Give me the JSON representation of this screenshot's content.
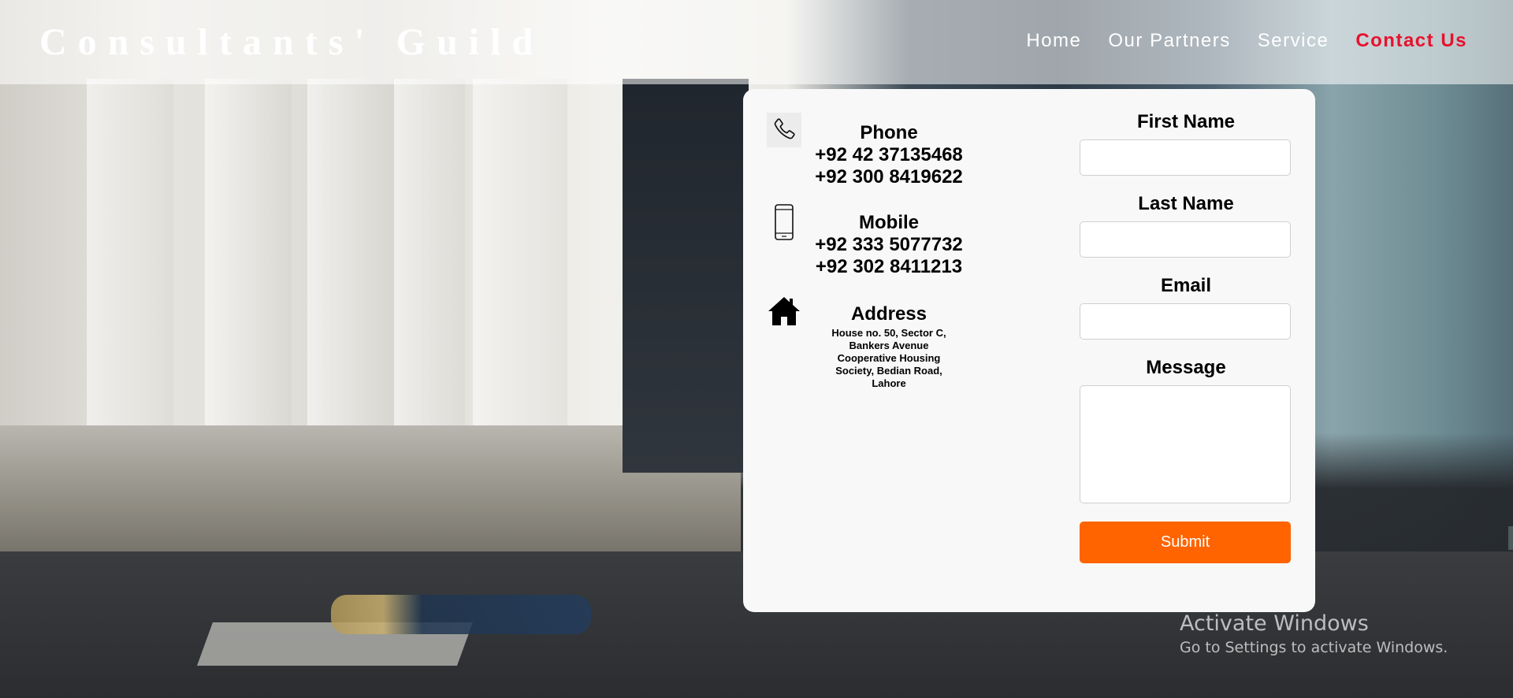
{
  "brand": {
    "name": "Consultants' Guild"
  },
  "nav": {
    "items": [
      {
        "label": "Home"
      },
      {
        "label": "Our Partners"
      },
      {
        "label": "Service"
      },
      {
        "label": "Contact Us",
        "active": true
      }
    ],
    "active_color": "#e8112d"
  },
  "contact": {
    "phone": {
      "icon": "phone-handset-icon",
      "title": "Phone",
      "lines": [
        "+92 42 37135468",
        "+92 300 8419622"
      ]
    },
    "mobile": {
      "icon": "mobile-phone-icon",
      "title": "Mobile",
      "lines": [
        "+92 333 5077732",
        "+92 302 8411213"
      ]
    },
    "address": {
      "icon": "home-icon",
      "title": "Address",
      "body": "House no. 50, Sector C, Bankers Avenue Cooperative Housing Society, Bedian Road, Lahore"
    }
  },
  "form": {
    "first_name_label": "First Name",
    "first_name_value": "",
    "last_name_label": "Last Name",
    "last_name_value": "",
    "email_label": "Email",
    "email_value": "",
    "message_label": "Message",
    "message_value": "",
    "submit_label": "Submit",
    "submit_color": "#ff6400"
  },
  "watermark": {
    "title": "Activate Windows",
    "subtitle": "Go to Settings to activate Windows."
  }
}
